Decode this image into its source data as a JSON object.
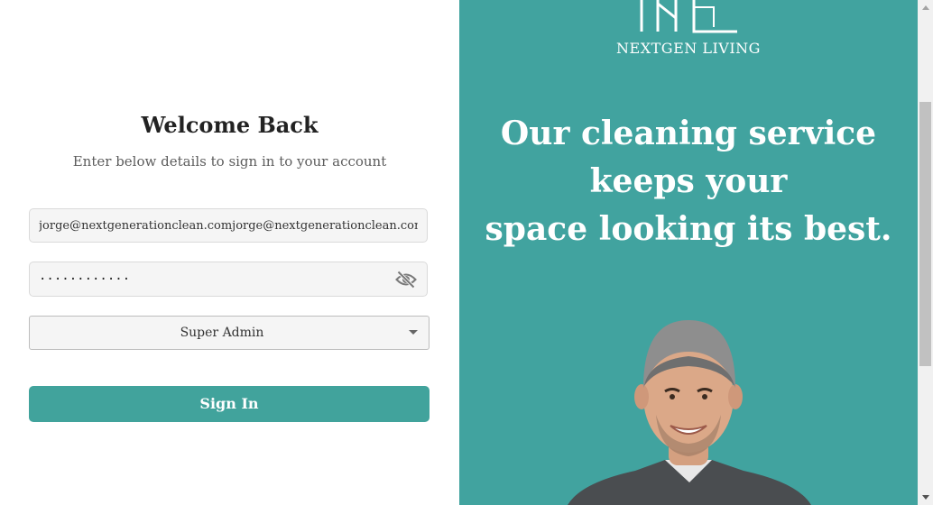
{
  "login": {
    "title": "Welcome Back",
    "subtitle": "Enter below details to sign in to your account",
    "email_value": "jorge@nextgenerationclean.comjorge@nextgenerationclean.comjorge@nextgenerationclean.com",
    "password_value": "············",
    "password_toggle_icon": "eye-off-icon",
    "role_selected": "Super Admin",
    "sign_in_label": "Sign In"
  },
  "promo": {
    "brand": "NEXTGEN LIVING",
    "headline_lines": [
      "Our cleaning service",
      "keeps your",
      "space looking its best."
    ],
    "background_color": "#41a39f"
  },
  "colors": {
    "accent": "#41a39c",
    "panel": "#41a39f"
  }
}
